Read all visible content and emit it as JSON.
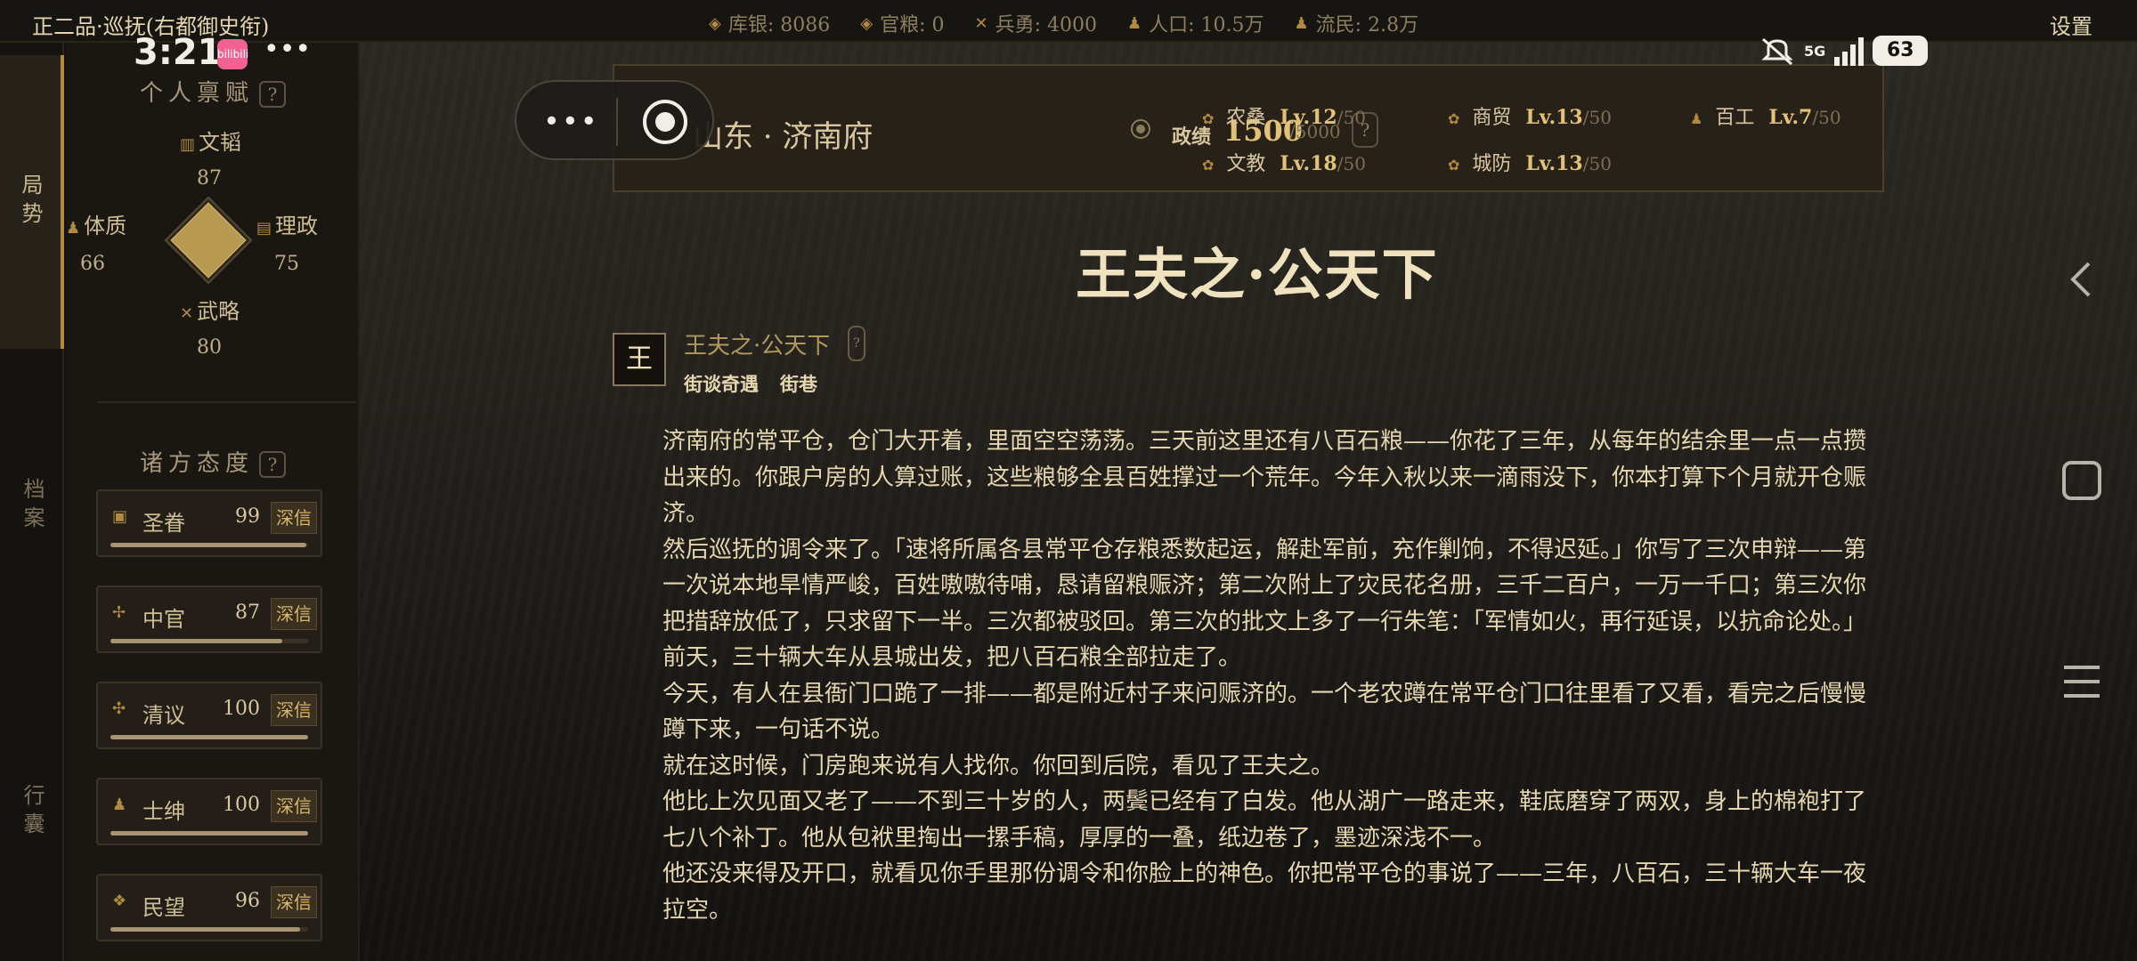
{
  "topbar": {
    "rank": "正二品·巡抚(右都御史衔)",
    "resources": [
      {
        "label": "库银: 8086",
        "icon": "silver-icon"
      },
      {
        "label": "官粮: 0",
        "icon": "grain-icon"
      },
      {
        "label": "兵勇: 4000",
        "icon": "soldier-icon"
      },
      {
        "label": "人口: 10.5万",
        "icon": "population-icon"
      },
      {
        "label": "流民: 2.8万",
        "icon": "refugee-icon"
      }
    ],
    "settings": "设置"
  },
  "status": {
    "time": "3:21",
    "app_badge": "bilibili",
    "net": "5G",
    "battery": "63"
  },
  "leftnav": {
    "tabs": [
      {
        "label": "局势",
        "active": true
      },
      {
        "label": "档案"
      },
      {
        "label": "行囊"
      }
    ]
  },
  "talent": {
    "title": "个人禀赋",
    "help": "?",
    "attrs": {
      "top": {
        "name": "文韬",
        "value": "87"
      },
      "left": {
        "name": "体质",
        "value": "66"
      },
      "right": {
        "name": "理政",
        "value": "75"
      },
      "bottom": {
        "name": "武略",
        "value": "80"
      }
    }
  },
  "factions": {
    "title": "诸方态度",
    "help": "?",
    "items": [
      {
        "name": "圣眷",
        "value": "99",
        "badge": "深信",
        "progress": 0.99
      },
      {
        "name": "中官",
        "value": "87",
        "badge": "深信",
        "progress": 0.87
      },
      {
        "name": "清议",
        "value": "100",
        "badge": "深信",
        "progress": 1.0
      },
      {
        "name": "士绅",
        "value": "100",
        "badge": "深信",
        "progress": 1.0
      },
      {
        "name": "民望",
        "value": "96",
        "badge": "深信",
        "progress": 0.96
      }
    ]
  },
  "city": {
    "name": "山东 · 济南府",
    "perf_label": "政绩",
    "perf_value": "1500",
    "perf_max": "/5000",
    "help": "?",
    "stats": [
      {
        "name": "农桑",
        "level": "Lv.12",
        "max": "/50"
      },
      {
        "name": "商贸",
        "level": "Lv.13",
        "max": "/50"
      },
      {
        "name": "百工",
        "level": "Lv.7",
        "max": "/50"
      },
      {
        "name": "文教",
        "level": "Lv.18",
        "max": "/50"
      },
      {
        "name": "城防",
        "level": "Lv.13",
        "max": "/50"
      }
    ]
  },
  "article": {
    "title": "王夫之·公天下",
    "avatar": "王",
    "source": "王夫之·公天下",
    "source_help": "?",
    "tags": [
      "街谈奇遇",
      "街巷"
    ],
    "paragraphs": [
      "济南府的常平仓，仓门大开着，里面空空荡荡。三天前这里还有八百石粮——你花了三年，从每年的结余里一点一点攒出来的。你跟户房的人算过账，这些粮够全县百姓撑过一个荒年。今年入秋以来一滴雨没下，你本打算下个月就开仓赈济。",
      "然后巡抚的调令来了。「速将所属各县常平仓存粮悉数起运，解赴军前，充作剿饷，不得迟延。」你写了三次申辩——第一次说本地旱情严峻，百姓嗷嗷待哺，恳请留粮赈济；第二次附上了灾民花名册，三千二百户，一万一千口；第三次你把措辞放低了，只求留下一半。三次都被驳回。第三次的批文上多了一行朱笔：「军情如火，再行延误，以抗命论处。」",
      "前天，三十辆大车从县城出发，把八百石粮全部拉走了。",
      "今天，有人在县衙门口跪了一排——都是附近村子来问赈济的。一个老农蹲在常平仓门口往里看了又看，看完之后慢慢蹲下来，一句话不说。",
      "就在这时候，门房跑来说有人找你。你回到后院，看见了王夫之。",
      "他比上次见面又老了——不到三十岁的人，两鬓已经有了白发。他从湖广一路走来，鞋底磨穿了两双，身上的棉袍打了七八个补丁。他从包袱里掏出一摞手稿，厚厚的一叠，纸边卷了，墨迹深浅不一。",
      "他还没来得及开口，就看见你手里那份调令和你脸上的神色。你把常平仓的事说了——三年，八百石，三十辆大车一夜拉空。"
    ]
  }
}
